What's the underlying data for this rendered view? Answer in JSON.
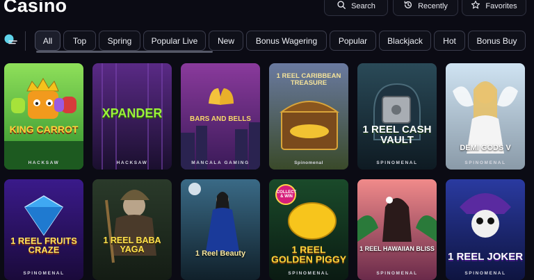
{
  "header": {
    "title": "Casino",
    "buttons": [
      {
        "label": "Search",
        "icon": "search-icon"
      },
      {
        "label": "Recently",
        "icon": "history-icon"
      },
      {
        "label": "Favorites",
        "icon": "star-icon"
      }
    ]
  },
  "filters": {
    "menu_icon": "menu-toggle-icon",
    "tabs": [
      "All",
      "Top",
      "Spring",
      "Popular Live",
      "New",
      "Bonus Wagering",
      "Popular",
      "Blackjack",
      "Hot",
      "Bonus Buy"
    ],
    "active": "All"
  },
  "games": {
    "row1": [
      {
        "name": "KING CARROT",
        "provider": "HACKSAW"
      },
      {
        "name": "XPANDER",
        "provider": "HACKSAW"
      },
      {
        "name": "BARS AND BELLS",
        "provider": "MANCALA GAMING"
      },
      {
        "name": "1 REEL CARIBBEAN TREASURE",
        "provider": "Spinomenal"
      },
      {
        "name": "1 REEL CASH VAULT",
        "provider": "SPINOMENAL"
      },
      {
        "name": "DEMI GODS V",
        "provider": "SPINOMENAL"
      }
    ],
    "row2": [
      {
        "name": "1 REEL FRUITS CRAZE",
        "provider": "SPINOMENAL"
      },
      {
        "name": "1 REEL BABA YAGA",
        "provider": ""
      },
      {
        "name": "1 Reel Beauty",
        "provider": ""
      },
      {
        "name": "1 REEL GOLDEN PIGGY",
        "provider": "SPINOMENAL",
        "badge": "COLLECT & WIN"
      },
      {
        "name": "1 REEL HAWAIIAN BLISS",
        "provider": "SPINOMENAL"
      },
      {
        "name": "1 REEL JOKER",
        "provider": "SPINOMENAL"
      }
    ]
  },
  "colors": {
    "background": "#0b0b14",
    "pill_border": "#3a3c4c",
    "accent_cyan": "#5fd3ea"
  }
}
